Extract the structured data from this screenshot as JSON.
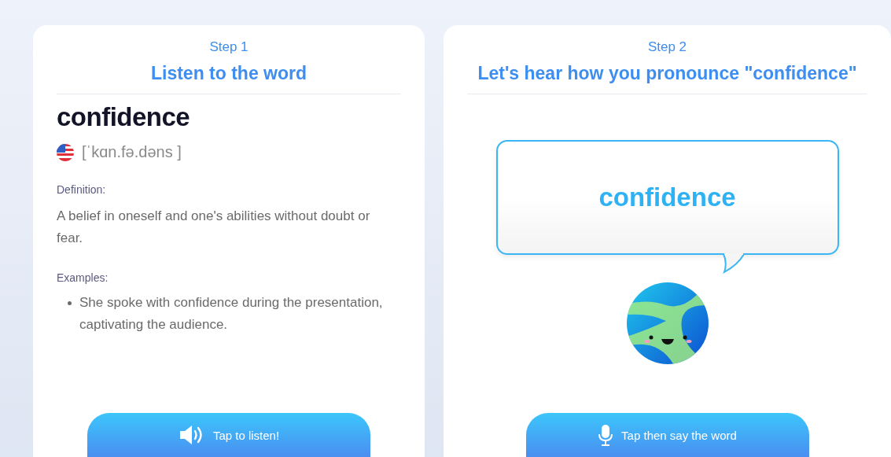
{
  "listen_card": {
    "step": "Step 1",
    "title": "Listen to the word",
    "word": "confidence",
    "pronunciation": "[ˈkɑn.fə.dəns ]",
    "definition_label": "Definition:",
    "definition": "A belief in oneself and one's abilities without doubt or fear.",
    "examples_label": "Examples:",
    "examples": [
      "She spoke with confidence during the presentation, captivating the audience."
    ],
    "button": "Tap to listen!"
  },
  "speak_card": {
    "step": "Step 2",
    "title": "Let's hear how you pronounce \"confidence\"",
    "bubble_word": "confidence",
    "button": "Tap then say the word"
  }
}
